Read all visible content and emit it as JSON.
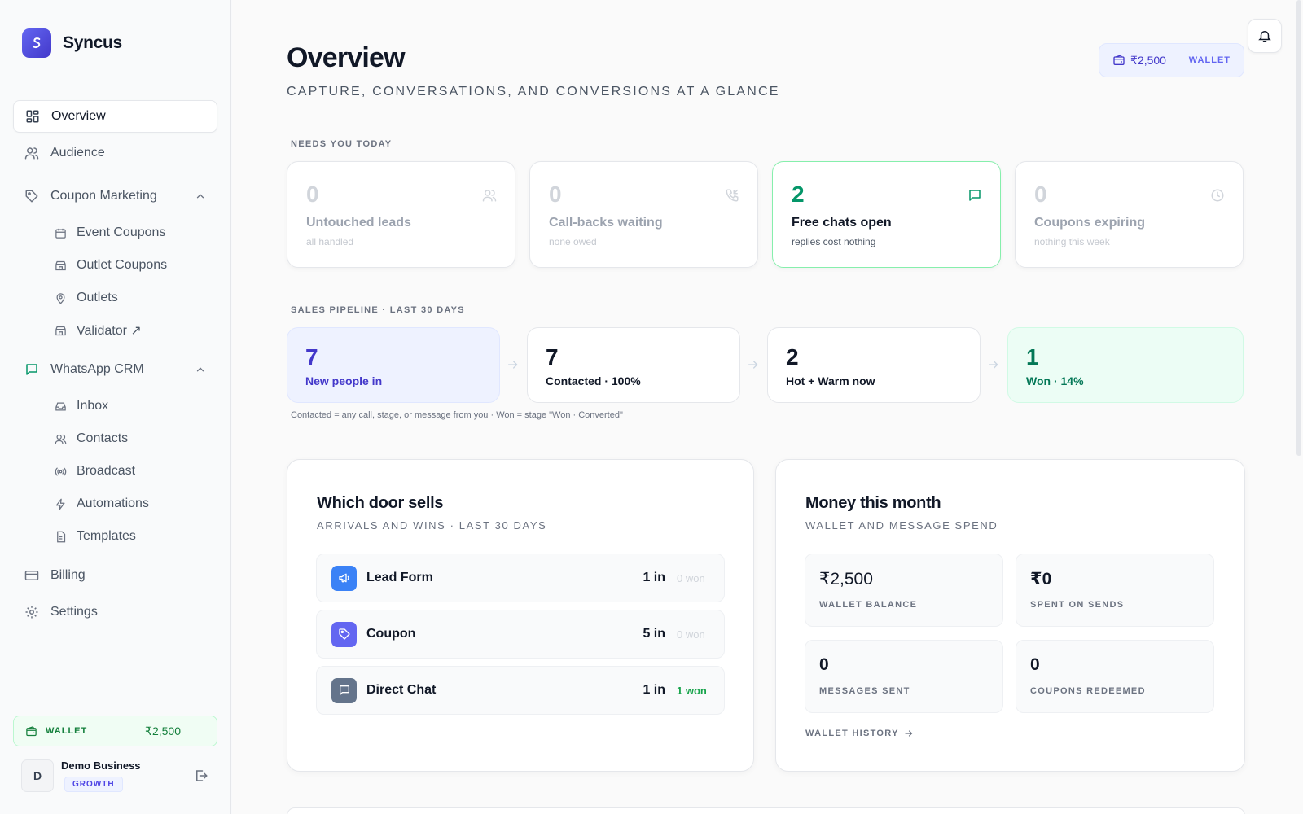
{
  "brand": {
    "name": "Syncus"
  },
  "sidebar": {
    "overview": "Overview",
    "audience": "Audience",
    "coupon_marketing": {
      "label": "Coupon Marketing",
      "items": [
        "Event Coupons",
        "Outlet Coupons",
        "Outlets",
        "Validator ↗"
      ]
    },
    "whatsapp_crm": {
      "label": "WhatsApp CRM",
      "items": [
        "Inbox",
        "Contacts",
        "Broadcast",
        "Automations",
        "Templates"
      ]
    },
    "billing": "Billing",
    "settings": "Settings",
    "wallet": {
      "label": "WALLET",
      "amount": "₹2,500"
    },
    "user": {
      "initial": "D",
      "name": "Demo Business",
      "plan": "GROWTH"
    }
  },
  "header": {
    "title": "Overview",
    "subtitle": "CAPTURE, CONVERSATIONS, AND CONVERSIONS AT A GLANCE",
    "wallet_amount": "₹2,500",
    "wallet_label": "WALLET"
  },
  "needs": {
    "label": "NEEDS YOU TODAY",
    "cards": [
      {
        "value": "0",
        "title": "Untouched leads",
        "sub": "all handled",
        "icon": "users-icon"
      },
      {
        "value": "0",
        "title": "Call-backs waiting",
        "sub": "none owed",
        "icon": "phone-callback-icon"
      },
      {
        "value": "2",
        "title": "Free chats open",
        "sub": "replies cost nothing",
        "icon": "chat-bubble-icon"
      },
      {
        "value": "0",
        "title": "Coupons expiring",
        "sub": "nothing this week",
        "icon": "clock-icon"
      }
    ]
  },
  "pipeline": {
    "label": "SALES PIPELINE · LAST 30 DAYS",
    "stages": [
      {
        "value": "7",
        "title": "New people in"
      },
      {
        "value": "7",
        "title": "Contacted · 100%"
      },
      {
        "value": "2",
        "title": "Hot + Warm now"
      },
      {
        "value": "1",
        "title": "Won · 14%"
      }
    ],
    "note": "Contacted = any call, stage, or message from you · Won = stage \"Won · Converted\""
  },
  "doors": {
    "title": "Which door sells",
    "subtitle": "ARRIVALS AND WINS · LAST 30 DAYS",
    "rows": [
      {
        "name": "Lead Form",
        "in": "1 in",
        "won": "0 won",
        "color": "#3b82f6",
        "icon": "megaphone-icon"
      },
      {
        "name": "Coupon",
        "in": "5 in",
        "won": "0 won",
        "color": "#6366f1",
        "icon": "tag-icon"
      },
      {
        "name": "Direct Chat",
        "in": "1 in",
        "won": "1 won",
        "color": "#64748b",
        "icon": "chat-bubble-icon"
      }
    ]
  },
  "money": {
    "title": "Money this month",
    "subtitle": "WALLET AND MESSAGE SPEND",
    "cards": [
      {
        "value": "₹2,500",
        "label": "WALLET BALANCE"
      },
      {
        "value": "₹0",
        "label": "SPENT ON SENDS"
      },
      {
        "value": "0",
        "label": "MESSAGES SENT"
      },
      {
        "value": "0",
        "label": "COUPONS REDEEMED"
      }
    ],
    "history_link": "WALLET HISTORY"
  },
  "colors": {
    "accent": "#4f46e5",
    "success": "#059669",
    "border": "#e5e7eb"
  }
}
